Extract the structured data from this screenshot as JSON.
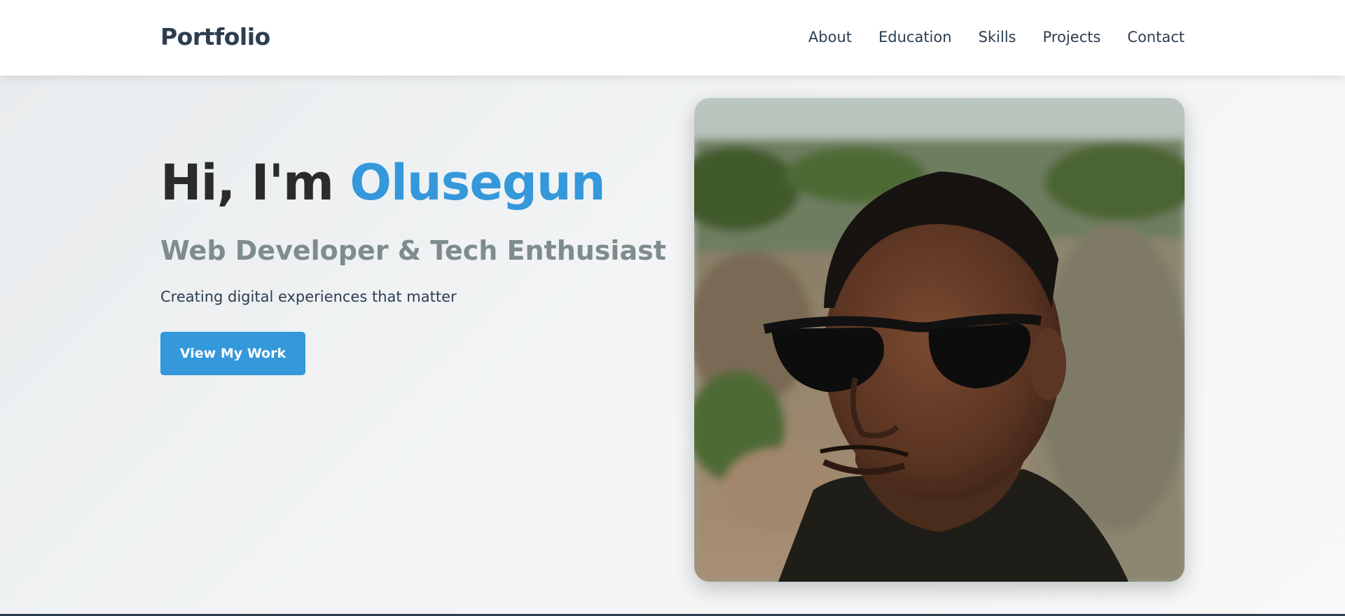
{
  "navbar": {
    "brand": "Portfolio",
    "links": [
      {
        "label": "About"
      },
      {
        "label": "Education"
      },
      {
        "label": "Skills"
      },
      {
        "label": "Projects"
      },
      {
        "label": "Contact"
      }
    ]
  },
  "hero": {
    "greeting": "Hi, I'm ",
    "name": "Olusegun",
    "subtitle": "Web Developer & Tech Enthusiast",
    "tagline": "Creating digital experiences that matter",
    "cta_label": "View My Work"
  },
  "colors": {
    "accent": "#3498db",
    "heading": "#2b2b2b",
    "nav_text": "#2c3e50",
    "subtitle": "#7f8c8d"
  }
}
